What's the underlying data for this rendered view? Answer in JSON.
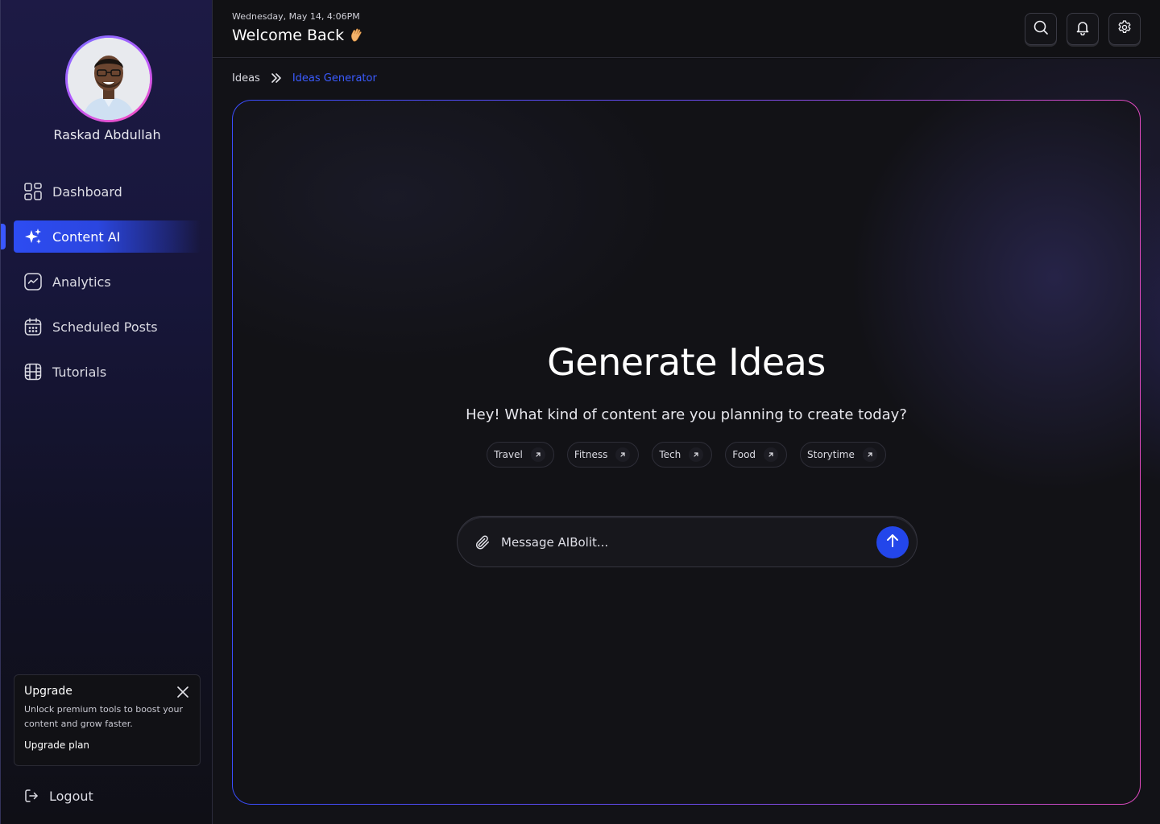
{
  "user": {
    "name": "Raskad Abdullah"
  },
  "sidebar": {
    "items": [
      {
        "label": "Dashboard",
        "icon": "dashboard-grid-icon"
      },
      {
        "label": "Content AI",
        "icon": "sparkles-icon",
        "active": true
      },
      {
        "label": "Analytics",
        "icon": "analytics-chart-icon"
      },
      {
        "label": "Scheduled Posts",
        "icon": "calendar-icon"
      },
      {
        "label": "Tutorials",
        "icon": "film-icon"
      }
    ],
    "upgrade": {
      "title": "Upgrade",
      "description": "Unlock premium tools to boost your content and grow faster.",
      "link": "Upgrade plan"
    },
    "logout": "Logout"
  },
  "header": {
    "date": "Wednesday, May 14, 4:06PM",
    "title": "Welcome Back",
    "actions": [
      "search-icon",
      "bell-icon",
      "gear-icon"
    ]
  },
  "breadcrumb": {
    "items": [
      "Ideas",
      "Ideas Generator"
    ]
  },
  "hero": {
    "title": "Generate Ideas",
    "subtitle": "Hey! What kind of content are you planning to create today?",
    "chips": [
      "Travel",
      "Fitness",
      "Tech",
      "Food",
      "Storytime"
    ]
  },
  "composer": {
    "placeholder": "Message AIBolit...",
    "value": ""
  },
  "colors": {
    "accent": "#2346ea",
    "active_nav": "#2d4cf2",
    "breadcrumb_current": "#3b5bff",
    "frame_gradient_start": "#3a4dff",
    "frame_gradient_end": "#e04ac0"
  }
}
